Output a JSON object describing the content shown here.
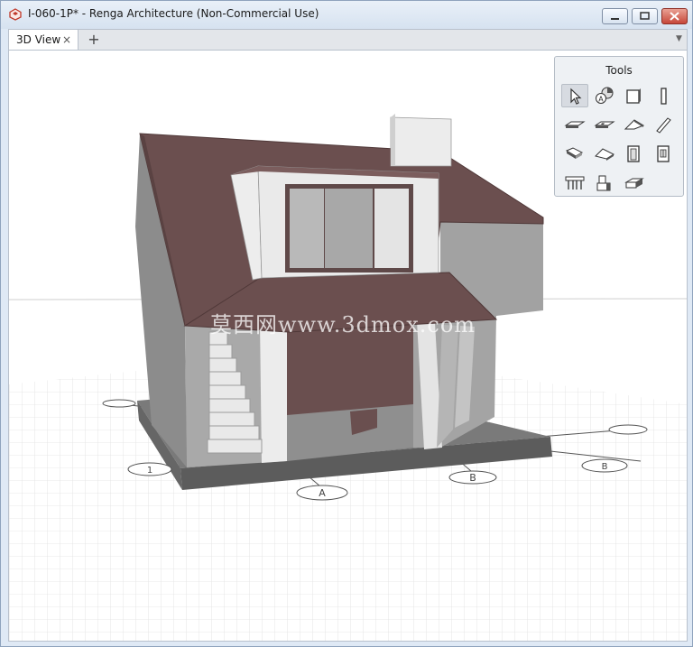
{
  "window": {
    "title": "I-060-1P* - Renga Architecture (Non-Commercial Use)",
    "icon": "renga-app-icon",
    "controls": [
      "minimize-icon",
      "maximize-icon",
      "close-icon"
    ]
  },
  "tabs": {
    "active_label": "3D View",
    "close_glyph": "×",
    "add_glyph": "+",
    "menu_glyph": "▼"
  },
  "tools": {
    "title": "Tools",
    "items": [
      {
        "icon": "select-arrow-icon",
        "selected": true
      },
      {
        "icon": "annotation-icon",
        "selected": false
      },
      {
        "icon": "wall-icon",
        "selected": false
      },
      {
        "icon": "column-icon",
        "selected": false
      },
      {
        "icon": "floor-slab-icon",
        "selected": false
      },
      {
        "icon": "opening-icon",
        "selected": false
      },
      {
        "icon": "roof-icon",
        "selected": false
      },
      {
        "icon": "beam-icon",
        "selected": false
      },
      {
        "icon": "stair-icon",
        "selected": false
      },
      {
        "icon": "ramp-icon",
        "selected": false
      },
      {
        "icon": "door-icon",
        "selected": false
      },
      {
        "icon": "window-icon",
        "selected": false
      },
      {
        "icon": "railing-icon",
        "selected": false
      },
      {
        "icon": "equipment-icon",
        "selected": false
      },
      {
        "icon": "assembly-icon",
        "selected": false
      }
    ]
  },
  "axes": {
    "markers": [
      "A",
      "B",
      "B",
      "1"
    ]
  },
  "watermark": "莫西网www.3dmox.com",
  "colors": {
    "roof": "#6b4f4f",
    "wall_light": "#eaeaea",
    "wall_dark": "#9a9a9a",
    "base": "#6e6e6e",
    "grid": "#d2d2d2"
  }
}
